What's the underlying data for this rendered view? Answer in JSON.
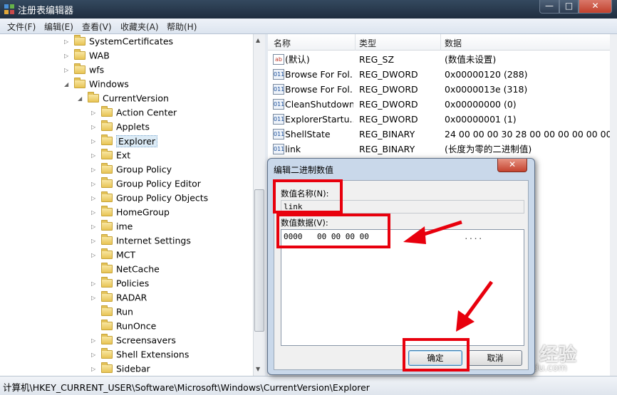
{
  "window": {
    "title": "注册表编辑器",
    "min": "—",
    "max": "□",
    "close": "✕"
  },
  "menu": [
    "文件(F)",
    "编辑(E)",
    "查看(V)",
    "收藏夹(A)",
    "帮助(H)"
  ],
  "tree": {
    "items": [
      {
        "label": "SystemCertificates",
        "toggle": "▷"
      },
      {
        "label": "WAB",
        "toggle": "▷"
      },
      {
        "label": "wfs",
        "toggle": "▷"
      },
      {
        "label": "Windows",
        "toggle": "◢"
      },
      {
        "label": "CurrentVersion",
        "toggle": "◢"
      },
      {
        "label": "Action Center",
        "toggle": "▷"
      },
      {
        "label": "Applets",
        "toggle": "▷"
      },
      {
        "label": "Explorer",
        "toggle": "▷"
      },
      {
        "label": "Ext",
        "toggle": "▷"
      },
      {
        "label": "Group Policy",
        "toggle": "▷"
      },
      {
        "label": "Group Policy Editor",
        "toggle": "▷"
      },
      {
        "label": "Group Policy Objects",
        "toggle": "▷"
      },
      {
        "label": "HomeGroup",
        "toggle": "▷"
      },
      {
        "label": "ime",
        "toggle": "▷"
      },
      {
        "label": "Internet Settings",
        "toggle": "▷"
      },
      {
        "label": "MCT",
        "toggle": "▷"
      },
      {
        "label": "NetCache",
        "toggle": ""
      },
      {
        "label": "Policies",
        "toggle": "▷"
      },
      {
        "label": "RADAR",
        "toggle": "▷"
      },
      {
        "label": "Run",
        "toggle": ""
      },
      {
        "label": "RunOnce",
        "toggle": ""
      },
      {
        "label": "Screensavers",
        "toggle": "▷"
      },
      {
        "label": "Shell Extensions",
        "toggle": "▷"
      },
      {
        "label": "Sidebar",
        "toggle": "▷"
      }
    ]
  },
  "list": {
    "headers": {
      "name": "名称",
      "type": "类型",
      "data": "数据"
    },
    "rows": [
      {
        "icon": "ab",
        "name": "(默认)",
        "type": "REG_SZ",
        "data": "(数值未设置)"
      },
      {
        "icon": "011",
        "name": "Browse For Fol...",
        "type": "REG_DWORD",
        "data": "0x00000120 (288)"
      },
      {
        "icon": "011",
        "name": "Browse For Fol...",
        "type": "REG_DWORD",
        "data": "0x0000013e (318)"
      },
      {
        "icon": "011",
        "name": "CleanShutdown",
        "type": "REG_DWORD",
        "data": "0x00000000 (0)"
      },
      {
        "icon": "011",
        "name": "ExplorerStartu...",
        "type": "REG_DWORD",
        "data": "0x00000001 (1)"
      },
      {
        "icon": "011",
        "name": "ShellState",
        "type": "REG_BINARY",
        "data": "24 00 00 00 30 28 00 00 00 00 00 00"
      },
      {
        "icon": "011",
        "name": "link",
        "type": "REG_BINARY",
        "data": "(长度为零的二进制值)"
      }
    ]
  },
  "dialog": {
    "title": "编辑二进制数值",
    "close": "✕",
    "name_label": "数值名称(N):",
    "name_value": "link",
    "data_label": "数值数据(V):",
    "hex_offset": "0000",
    "hex_bytes": "00 00 00 00",
    "hex_ascii": "....",
    "ok": "确定",
    "cancel": "取消"
  },
  "status": "计算机\\HKEY_CURRENT_USER\\Software\\Microsoft\\Windows\\CurrentVersion\\Explorer",
  "watermark": {
    "text": "Bai百 经验",
    "url": "jingyan.baidu.com"
  },
  "colors": {
    "highlight": "#e8000d",
    "selection": "#dcebf6",
    "title_bar": "#1f2d3f"
  }
}
